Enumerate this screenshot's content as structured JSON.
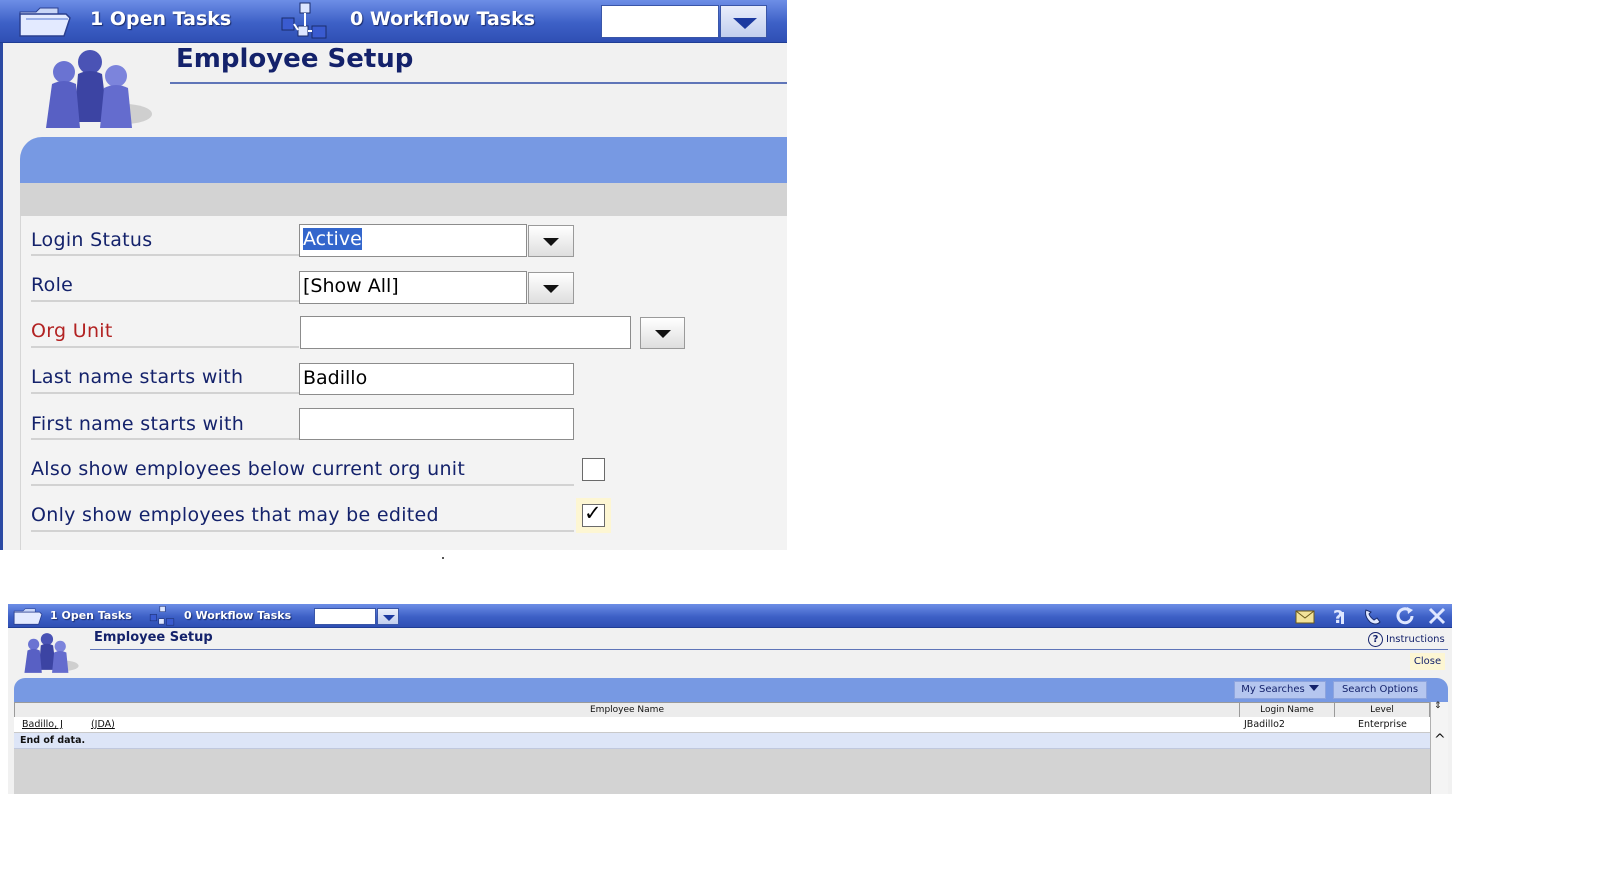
{
  "zoomed_panel": {
    "topbar": {
      "open_tasks": "1 Open Tasks",
      "workflow_tasks": "0 Workflow Tasks",
      "combo_value": ""
    },
    "page_title": "Employee Setup",
    "form": {
      "login_status": {
        "label": "Login Status",
        "value": "Active",
        "selected": true
      },
      "role": {
        "label": "Role",
        "value": "[Show All]"
      },
      "org_unit": {
        "label": "Org Unit",
        "value": "",
        "required_color": "#b22222"
      },
      "last_name": {
        "label": "Last name starts with",
        "value": "Badillo"
      },
      "first_name": {
        "label": "First name starts with",
        "value": ""
      },
      "show_below": {
        "label": "Also show employees below current org unit",
        "checked": false
      },
      "only_editable": {
        "label": "Only show employees that may be edited",
        "checked": true,
        "check_glyph": "✓"
      }
    }
  },
  "results_panel": {
    "topbar": {
      "open_tasks": "1 Open Tasks",
      "workflow_tasks": "0 Workflow Tasks",
      "combo_value": "",
      "icons": [
        "mail-icon",
        "help-icon",
        "phone-icon",
        "refresh-icon",
        "close-icon"
      ]
    },
    "page_title": "Employee Setup",
    "instructions_label": "Instructions",
    "instructions_glyph": "?",
    "close_label": "Close",
    "header_buttons": {
      "my_searches": "My Searches",
      "search_options": "Search Options"
    },
    "table": {
      "columns": [
        "Employee Name",
        "Login Name",
        "Level"
      ],
      "rows": [
        {
          "employee_name": "Badillo, J",
          "employee_code": "(JDA)",
          "login_name": "JBadillo2",
          "level": "Enterprise"
        }
      ],
      "end_text": "End of data."
    },
    "scrollbar": {
      "sort_glyph": "⇕",
      "up_glyph": "^"
    }
  },
  "colors": {
    "topbar_blue": "#3d60c6",
    "header_blue": "#7799e3",
    "title_navy": "#14226b",
    "label_red": "#b22222",
    "highlight_yellow": "#fdf6d3"
  }
}
